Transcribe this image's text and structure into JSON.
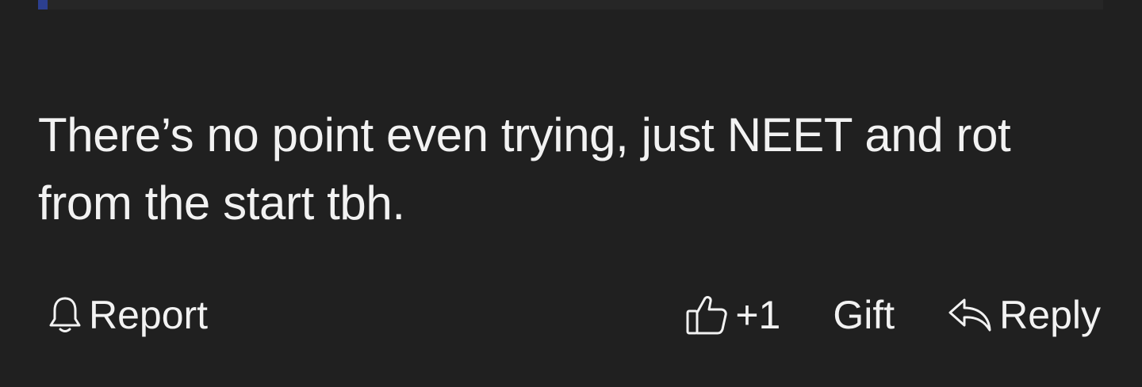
{
  "comment": {
    "text": "There’s no point even trying, just NEET and rot from the start tbh."
  },
  "actions": {
    "report_label": "Report",
    "like_count": "+1",
    "gift_label": "Gift",
    "reply_label": "Reply"
  },
  "icons": {
    "report": "bell-icon",
    "like": "thumbs-up-icon",
    "reply": "reply-arrow-icon"
  },
  "colors": {
    "background": "#202020",
    "text": "#f2f2f2",
    "quote_accent": "#2c3f8f"
  }
}
